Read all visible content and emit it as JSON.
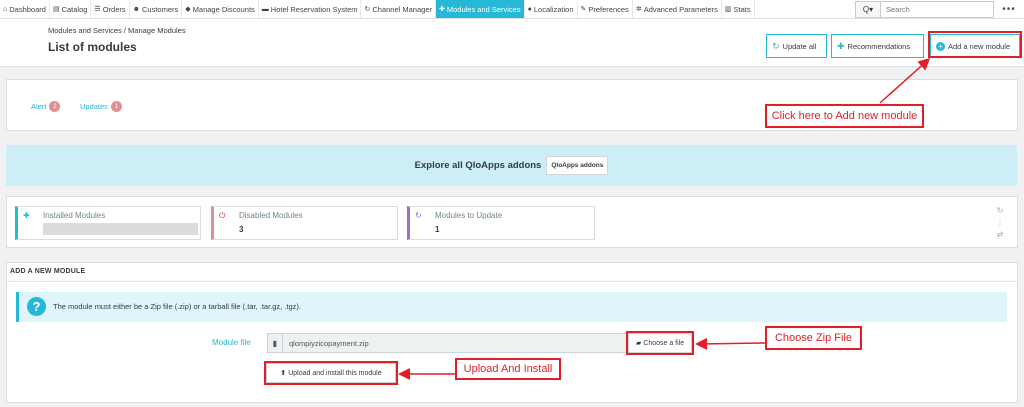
{
  "nav": {
    "items": [
      {
        "label": "Dashboard",
        "icon": "dashboard-icon",
        "glyph": "⌂"
      },
      {
        "label": "Catalog",
        "icon": "book-icon",
        "glyph": "▤"
      },
      {
        "label": "Orders",
        "icon": "orders-icon",
        "glyph": "☰"
      },
      {
        "label": "Customers",
        "icon": "users-icon",
        "glyph": "☻"
      },
      {
        "label": "Manage Discounts",
        "icon": "tag-icon",
        "glyph": "◆"
      },
      {
        "label": "Hotel Reservation System",
        "icon": "bed-icon",
        "glyph": "▬"
      },
      {
        "label": "Channel Manager",
        "icon": "refresh-icon",
        "glyph": "↻"
      },
      {
        "label": "Modules and Services",
        "icon": "puzzle-icon",
        "glyph": "✚"
      },
      {
        "label": "Localization",
        "icon": "globe-icon",
        "glyph": "●"
      },
      {
        "label": "Preferences",
        "icon": "wrench-icon",
        "glyph": "✎"
      },
      {
        "label": "Advanced Parameters",
        "icon": "cogs-icon",
        "glyph": "✲"
      },
      {
        "label": "Stats",
        "icon": "bar-chart-icon",
        "glyph": "▥"
      }
    ],
    "active_index": 7,
    "search_placeholder": "Search",
    "search_glyph": "Q▾",
    "more_glyph": "•••"
  },
  "header": {
    "breadcrumb": "Modules and Services  /  Manage Modules",
    "title": "List of modules",
    "update_all": "Update all",
    "recommendations": "Recommendations",
    "add_module": "Add a new module"
  },
  "tabs": {
    "alert_label": "Alert",
    "alert_count": "2",
    "updates_label": "Updates",
    "updates_count": "1"
  },
  "addons": {
    "text": "Explore all QloApps addons",
    "button": "QloApps addons"
  },
  "kpis": {
    "installed_label": "Installed Modules",
    "disabled_label": "Disabled Modules",
    "disabled_value": "3",
    "to_update_label": "Modules to Update",
    "to_update_value": "1"
  },
  "add_section": {
    "title": "ADD A NEW MODULE",
    "info": "The module must either be a Zip file (.zip) or a tarball file (.tar, .tar.gz, .tgz).",
    "field_label": "Module file",
    "file_value": "qlompiyzicopayment.zip",
    "choose_button": "Choose a file",
    "upload_button": "Upload and install this module"
  },
  "annotations": {
    "add_module": "Click here to Add new module",
    "choose_zip": "Choose Zip File",
    "upload_install": "Upload And Install"
  },
  "colors": {
    "accent": "#25b9d7",
    "annotation": "#e41e26",
    "disabled": "#e08f95",
    "to_update": "#a56cc1"
  }
}
